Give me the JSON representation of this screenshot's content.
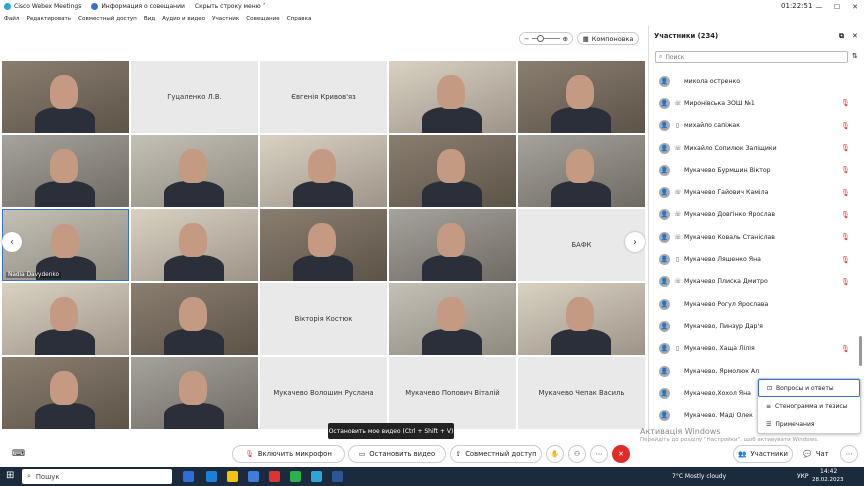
{
  "titlebar": {
    "app": "Cisco Webex Meetings",
    "info": "Информация о совещании",
    "hide": "Скрыть строку меню",
    "clock": "01:22:51"
  },
  "menu": [
    "Файл",
    "Редактировать",
    "Совместный доступ",
    "Вид",
    "Аудио и видео",
    "Участник",
    "Совещание",
    "Справка"
  ],
  "toolbar": {
    "layout_label": "Компоновка"
  },
  "tiles": [
    {
      "name": "",
      "video": true
    },
    {
      "name": "Гуцаленко Л.В.",
      "video": false
    },
    {
      "name": "Євгенія Кривов'яз",
      "video": false
    },
    {
      "name": "",
      "video": true
    },
    {
      "name": "",
      "video": true
    },
    {
      "name": "",
      "video": true
    },
    {
      "name": "",
      "video": true
    },
    {
      "name": "",
      "video": true
    },
    {
      "name": "",
      "video": true
    },
    {
      "name": "",
      "video": true
    },
    {
      "name": "Nadia Davydenko",
      "video": true,
      "active": true
    },
    {
      "name": "",
      "video": true
    },
    {
      "name": "",
      "video": true
    },
    {
      "name": "",
      "video": true
    },
    {
      "name": "БАФК",
      "video": false
    },
    {
      "name": "",
      "video": true
    },
    {
      "name": "",
      "video": true
    },
    {
      "name": "Вікторія Костюк",
      "video": false
    },
    {
      "name": "",
      "video": true
    },
    {
      "name": "",
      "video": true
    },
    {
      "name": "",
      "video": true
    },
    {
      "name": "",
      "video": true
    },
    {
      "name": "Мукачево Волошин Руслана",
      "video": false
    },
    {
      "name": "Мукачево Попович Віталій",
      "video": false
    },
    {
      "name": "Мукачево Чепак Василь",
      "video": false
    }
  ],
  "panel": {
    "title": "Участники (234)",
    "search_placeholder": "Поиск",
    "participants": [
      {
        "name": "микола остренко",
        "device": "",
        "mic": false
      },
      {
        "name": "Миронівська ЗОШ №1",
        "device": "☏",
        "mic": true
      },
      {
        "name": "михайло сапіжак",
        "device": "▯",
        "mic": true
      },
      {
        "name": "Михайло Сопилюк Заліщики",
        "device": "☏",
        "mic": true
      },
      {
        "name": "Мукачево Бурмшин Віктор",
        "device": "",
        "mic": true
      },
      {
        "name": "Мукачево Гайович Каміла",
        "device": "☏",
        "mic": true
      },
      {
        "name": "Мукачево Довгінко Ярослав",
        "device": "☏",
        "mic": true
      },
      {
        "name": "Мукачево Коваль Станіслав",
        "device": "☏",
        "mic": true
      },
      {
        "name": "Мукачево Ляшенко Яна",
        "device": "▯",
        "mic": true
      },
      {
        "name": "Мукачево Плиска Дмитро",
        "device": "☏",
        "mic": true
      },
      {
        "name": "Мукачево Рогул Ярослава",
        "device": "",
        "mic": false
      },
      {
        "name": "Мукачево, Пинзур Дар'я",
        "device": "",
        "mic": false
      },
      {
        "name": "Мукачево, Хаща Лілія",
        "device": "▯",
        "mic": true
      },
      {
        "name": "Мукачево, Ярмолюк Ал",
        "device": "",
        "mic": false
      },
      {
        "name": "Мукачево,Хохол Яна",
        "device": "",
        "mic": false
      },
      {
        "name": "Мукачево. Маді Олек",
        "device": "",
        "mic": false
      }
    ]
  },
  "popup": {
    "items": [
      "Вопросы и ответы",
      "Стенограмма и тезисы",
      "Примечания"
    ]
  },
  "tooltip": "Остановить мое видео (Ctrl + Shift + V)",
  "watermark": {
    "title": "Активація Windows",
    "sub": "Перейдіть до розділу \"Настройки\", щоб активувати Windows."
  },
  "controls": {
    "mic": "Включить микрофон",
    "video": "Остановить видео",
    "share": "Совместный доступ",
    "participants": "Участники",
    "chat": "Чат"
  },
  "taskbar": {
    "search": "Пошук",
    "weather": "7°C  Mostly cloudy",
    "lang": "УКР",
    "time": "14:42",
    "date": "28.02.2023"
  },
  "colors": {
    "accent": "#3a6fd1",
    "danger": "#e02b2b",
    "taskbar": "#1c2a3d"
  }
}
